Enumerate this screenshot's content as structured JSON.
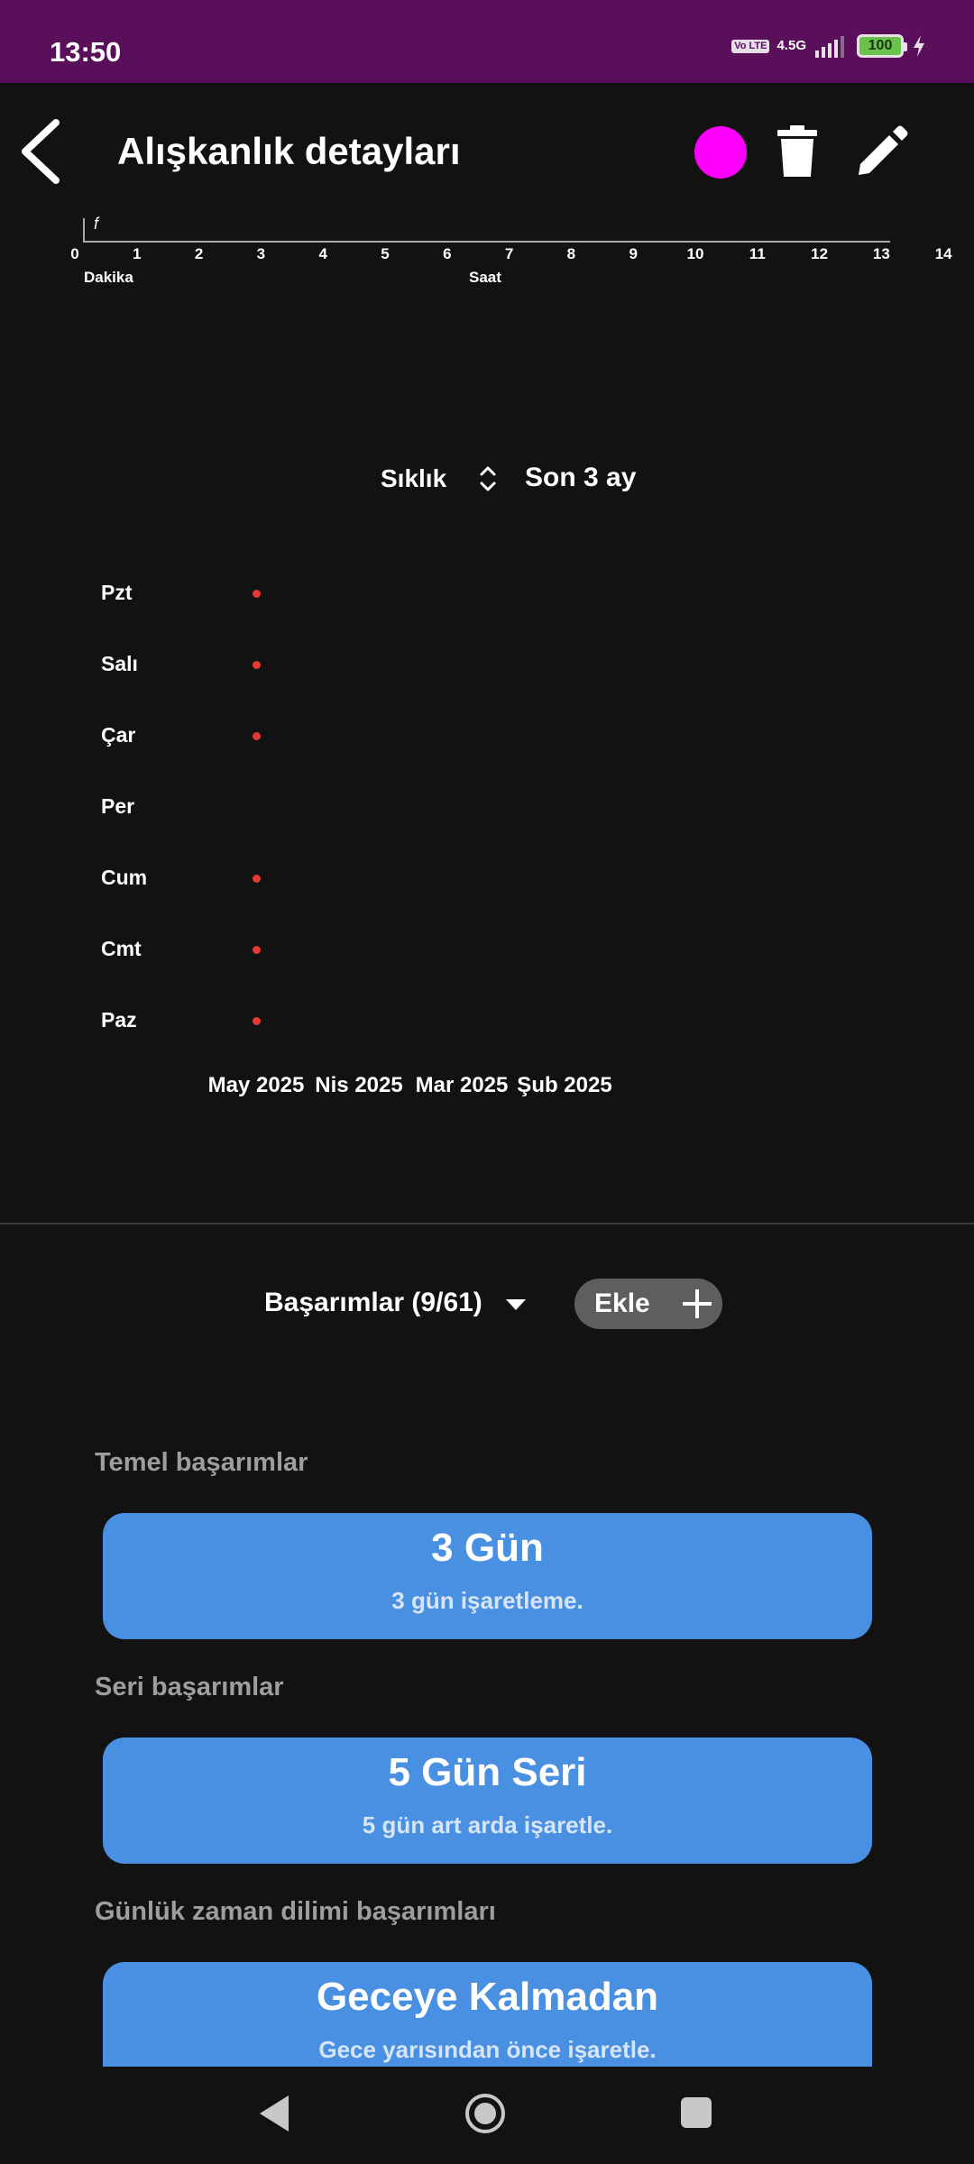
{
  "status_bar": {
    "time": "13:50",
    "volte": "Vo LTE",
    "network": "4.5G",
    "battery": "100"
  },
  "header": {
    "title": "Alışkanlık detayları",
    "habit_color": "#ff00ff",
    "back_icon": "back-arrow-icon",
    "delete_icon": "trash-icon",
    "edit_icon": "pencil-icon"
  },
  "time_axis": {
    "marker": "f",
    "ticks": [
      "0",
      "1",
      "2",
      "3",
      "4",
      "5",
      "6",
      "7",
      "8",
      "9",
      "10",
      "11",
      "12",
      "13",
      "14"
    ],
    "unit_left": "Dakika",
    "unit_center": "Saat"
  },
  "frequency": {
    "label": "Sıklık",
    "chevron_icon": "up-down-chevron-icon",
    "period": "Son 3 ay"
  },
  "chart_data": {
    "type": "scatter",
    "days": [
      "Pzt",
      "Salı",
      "Çar",
      "Per",
      "Cum",
      "Cmt",
      "Paz"
    ],
    "months": [
      "May 2025",
      "Nis 2025",
      "Mar 2025",
      "Şub 2025"
    ],
    "dot_color": "#e53935",
    "points": [
      {
        "day": "Pzt",
        "month": "May 2025"
      },
      {
        "day": "Salı",
        "month": "May 2025"
      },
      {
        "day": "Çar",
        "month": "May 2025"
      },
      {
        "day": "Cum",
        "month": "May 2025"
      },
      {
        "day": "Cmt",
        "month": "May 2025"
      },
      {
        "day": "Paz",
        "month": "May 2025"
      }
    ]
  },
  "achievements": {
    "title": "Başarımlar (9/61)",
    "add_label": "Ekle",
    "sections": [
      {
        "title": "Temel başarımlar",
        "card_title": "3 Gün",
        "card_subtitle": "3 gün işaretleme."
      },
      {
        "title": "Seri başarımlar",
        "card_title": "5 Gün Seri",
        "card_subtitle": "5 gün art arda işaretle."
      },
      {
        "title": "Günlük zaman dilimi başarımları",
        "card_title": "Geceye Kalmadan",
        "card_subtitle": "Gece yarısından önce işaretle."
      }
    ]
  },
  "nav_bar": {
    "back_icon": "nav-back-icon",
    "home_icon": "nav-home-icon",
    "recents_icon": "nav-recents-icon"
  }
}
